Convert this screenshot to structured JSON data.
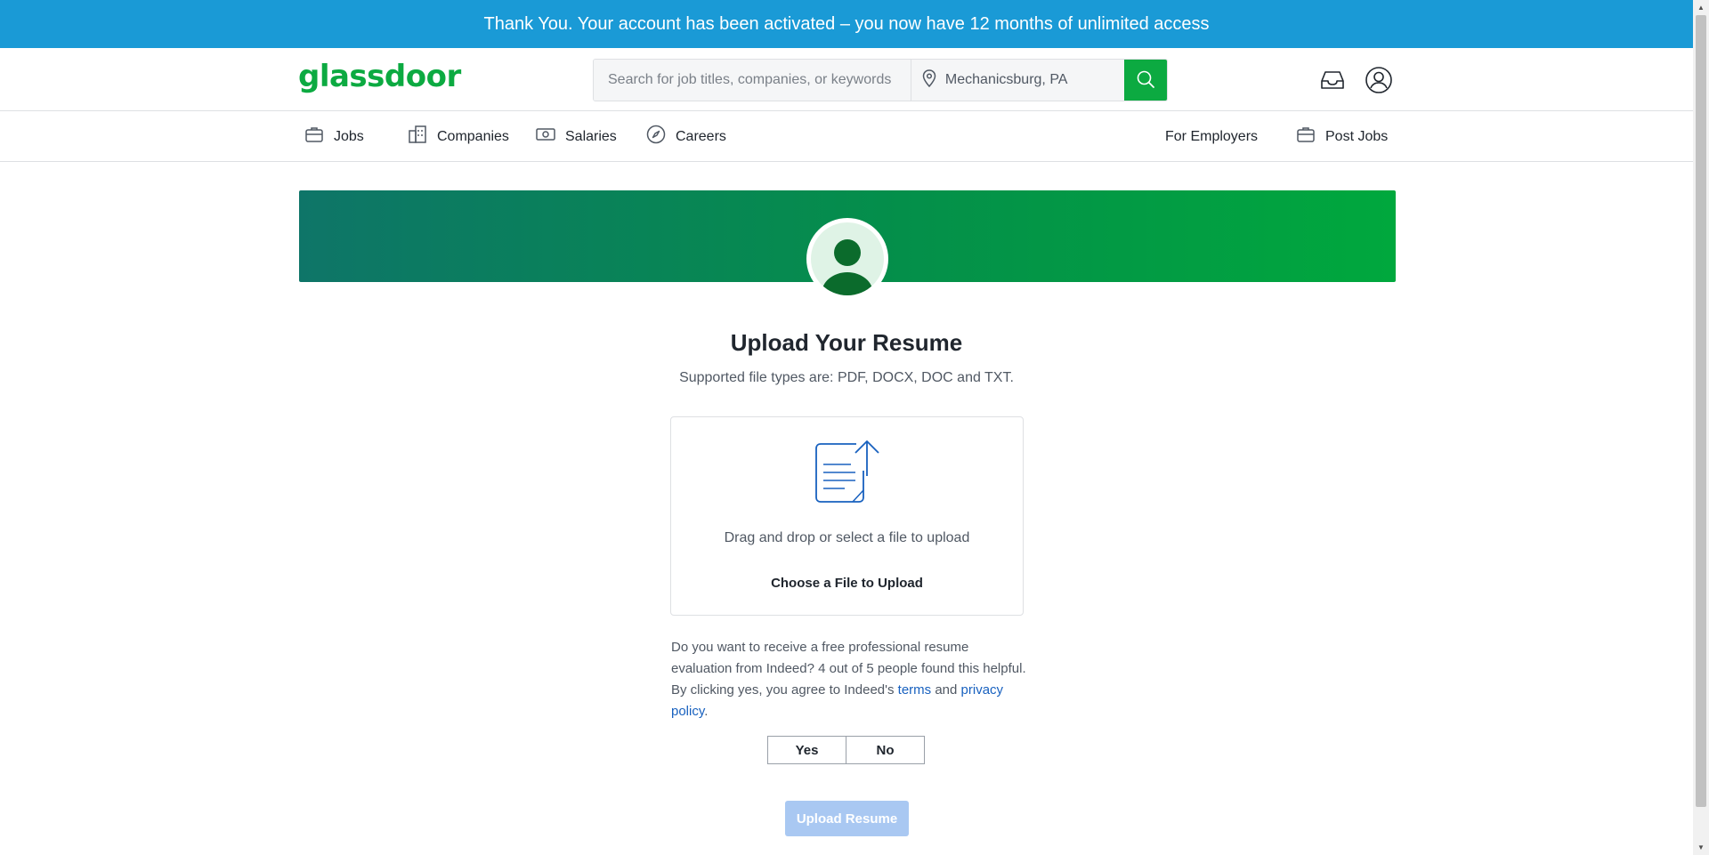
{
  "banner": {
    "text": "Thank You. Your account has been activated – you now have 12 months of unlimited access"
  },
  "header": {
    "logo": "glassdoor",
    "search_placeholder": "Search for job titles, companies, or keywords",
    "location_value": "Mechanicsburg, PA",
    "icons": [
      "inbox-icon",
      "profile-icon",
      "search-icon",
      "location-pin-icon"
    ]
  },
  "nav": {
    "jobs": "Jobs",
    "companies": "Companies",
    "salaries": "Salaries",
    "careers": "Careers",
    "for_employers": "For Employers",
    "post_jobs": "Post Jobs"
  },
  "main": {
    "title": "Upload Your Resume",
    "subtitle": "Supported file types are: PDF, DOCX, DOC and TXT.",
    "drop_text": "Drag and drop or select a file to upload",
    "choose_label": "Choose a File to Upload",
    "eval_text_1": "Do you want to receive a free professional resume evaluation from Indeed? 4 out of 5 people found this helpful. By clicking yes, you agree to Indeed's ",
    "terms_link": "terms",
    "eval_and": " and ",
    "privacy_link": "privacy policy",
    "eval_end": ".",
    "yes_label": "Yes",
    "no_label": "No",
    "upload_label": "Upload Resume"
  },
  "colors": {
    "banner": "#1a9ad6",
    "brand_green": "#0caa41",
    "link_blue": "#1861bf",
    "upload_disabled": "#a9c8f2"
  }
}
